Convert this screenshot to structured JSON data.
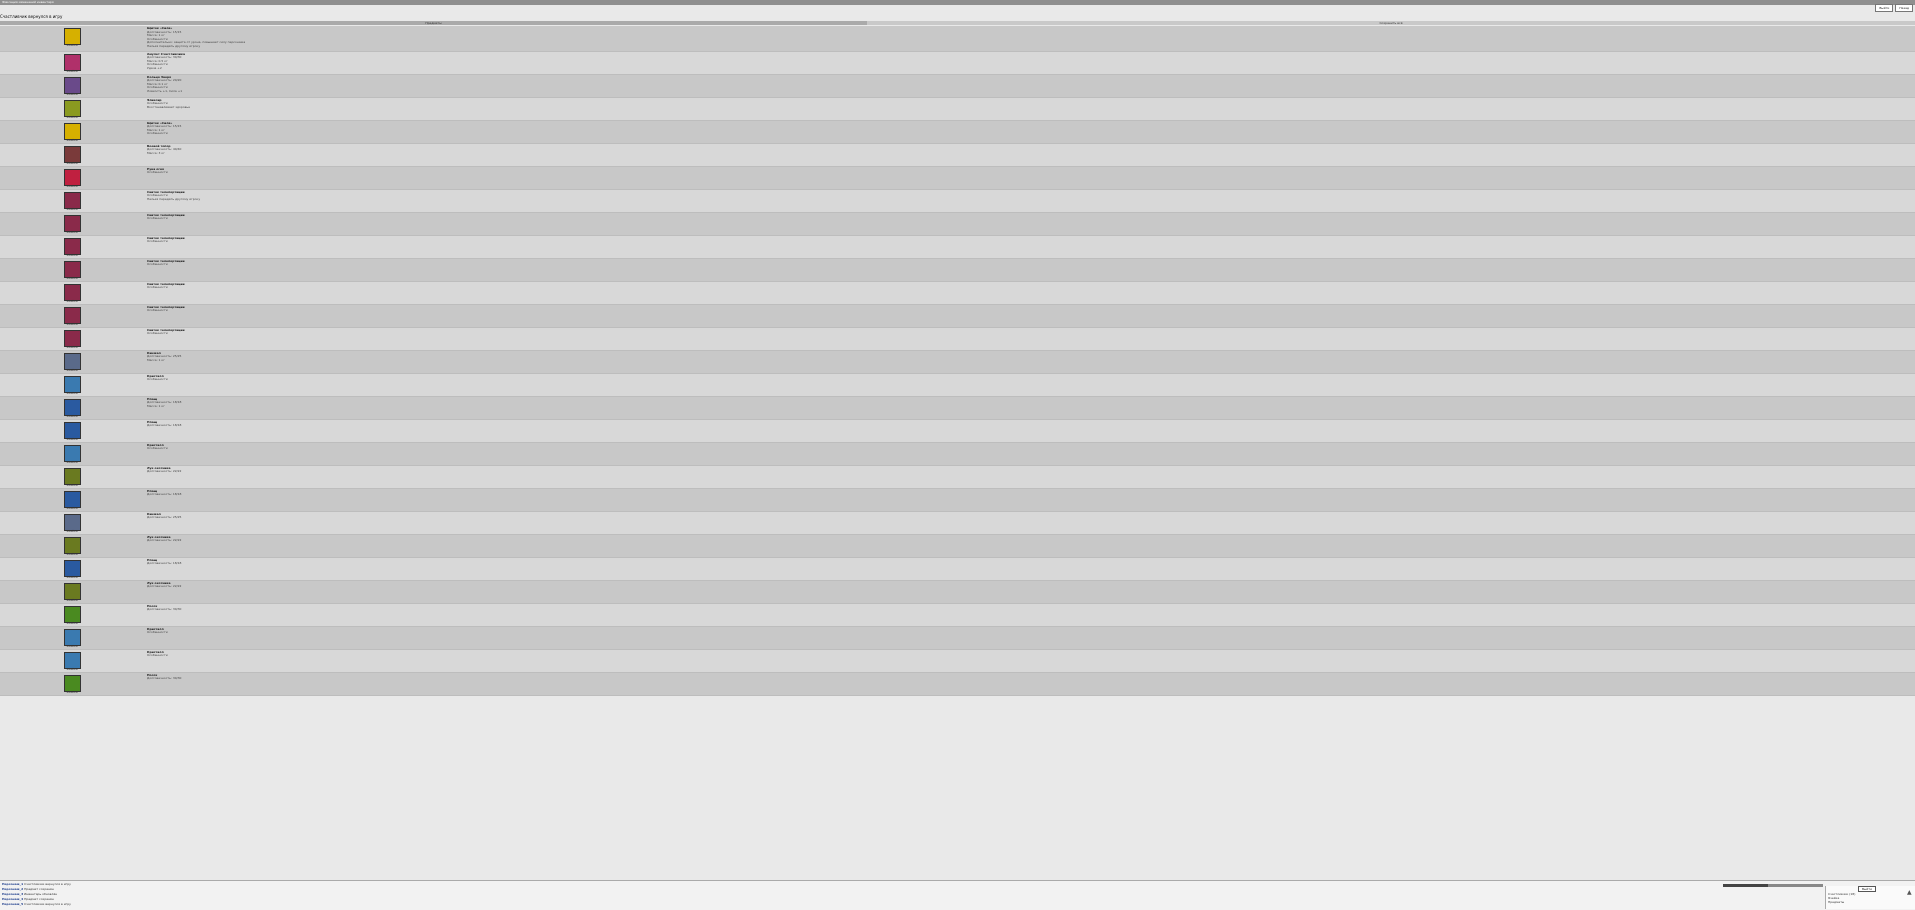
{
  "window": {
    "caption": "Фиксация изменений инвентаря"
  },
  "top_buttons": [
    "Выйти",
    "Назад"
  ],
  "title": "Счастливчик вернулся в игру",
  "columns": [
    "Предметы",
    "Сохранить всё"
  ],
  "rows": [
    {
      "icon_color": "#d6b000",
      "label": "Ячейка",
      "lines": [
        "Щиток «Сила»",
        "Долговечность: 15/15",
        "Масса: 1 кг",
        "Особенности",
        "Дополнительно: защита от урона, повышает силу персонажа",
        "Нельзя передать другому игроку"
      ]
    },
    {
      "icon_color": "#b0306a",
      "label": "Ячейка",
      "lines": [
        "Амулет Счастливчика",
        "Долговечность: 30/30",
        "Масса: 0.5 кг",
        "Особенности",
        "Удача +2"
      ]
    },
    {
      "icon_color": "#6a4a8a",
      "label": "Ячейка",
      "lines": [
        "Кольцо Зверя",
        "Долговечность: 20/20",
        "Масса: 0.1 кг",
        "Особенности",
        "Ловкость +1, Сила +1"
      ]
    },
    {
      "icon_color": "#8a9a20",
      "label": "Ячейка",
      "lines": [
        "Эликсир",
        "Особенности",
        "Восстанавливает здоровье"
      ]
    },
    {
      "icon_color": "#d6b000",
      "label": "Ячейка",
      "lines": [
        "Щиток «Сила»",
        "Долговечность: 15/15",
        "Масса: 1 кг",
        "Особенности"
      ]
    },
    {
      "icon_color": "#7a3a3a",
      "label": "Ячейка",
      "lines": [
        "Боевой топор",
        "Долговечность: 40/40",
        "Масса: 3 кг"
      ]
    },
    {
      "icon_color": "#c02040",
      "label": "Ячейка",
      "lines": [
        "Руна огня",
        "Особенности"
      ]
    },
    {
      "icon_color": "#8a2a4a",
      "label": "Ячейка",
      "lines": [
        "Свиток телепортации",
        "Особенности",
        "Нельзя передать другому игроку"
      ]
    },
    {
      "icon_color": "#8a2a4a",
      "label": "Ячейка",
      "lines": [
        "Свиток телепортации",
        "Особенности"
      ]
    },
    {
      "icon_color": "#8a2a4a",
      "label": "Ячейка",
      "lines": [
        "Свиток телепортации",
        "Особенности"
      ]
    },
    {
      "icon_color": "#8a2a4a",
      "label": "Ячейка",
      "lines": [
        "Свиток телепортации",
        "Особенности"
      ]
    },
    {
      "icon_color": "#8a2a4a",
      "label": "Ячейка",
      "lines": [
        "Свиток телепортации",
        "Особенности"
      ]
    },
    {
      "icon_color": "#8a2a4a",
      "label": "Ячейка",
      "lines": [
        "Свиток телепортации",
        "Особенности"
      ]
    },
    {
      "icon_color": "#8a2a4a",
      "label": "Ячейка",
      "lines": [
        "Свиток телепортации",
        "Особенности"
      ]
    },
    {
      "icon_color": "#5a6a8a",
      "label": "Ячейка",
      "lines": [
        "Кинжал",
        "Долговечность: 25/25",
        "Масса: 1 кг"
      ]
    },
    {
      "icon_color": "#3a7ab0",
      "label": "Ячейка",
      "lines": [
        "Кристалл",
        "Особенности"
      ]
    },
    {
      "icon_color": "#2a5aa0",
      "label": "Ячейка",
      "lines": [
        "Плащ",
        "Долговечность: 18/18",
        "Масса: 1 кг"
      ]
    },
    {
      "icon_color": "#2a5aa0",
      "label": "Ячейка",
      "lines": [
        "Плащ",
        "Долговечность: 18/18"
      ]
    },
    {
      "icon_color": "#3a7ab0",
      "label": "Ячейка",
      "lines": [
        "Кристалл",
        "Особенности"
      ]
    },
    {
      "icon_color": "#6a7a20",
      "label": "Ячейка",
      "lines": [
        "Лук охотника",
        "Долговечность: 22/22"
      ]
    },
    {
      "icon_color": "#2a5aa0",
      "label": "Ячейка",
      "lines": [
        "Плащ",
        "Долговечность: 18/18"
      ]
    },
    {
      "icon_color": "#5a6a8a",
      "label": "Ячейка",
      "lines": [
        "Кинжал",
        "Долговечность: 25/25"
      ]
    },
    {
      "icon_color": "#6a7a20",
      "label": "Ячейка",
      "lines": [
        "Лук охотника",
        "Долговечность: 22/22"
      ]
    },
    {
      "icon_color": "#2a5aa0",
      "label": "Ячейка",
      "lines": [
        "Плащ",
        "Долговечность: 18/18"
      ]
    },
    {
      "icon_color": "#6a7a20",
      "label": "Ячейка",
      "lines": [
        "Лук охотника",
        "Долговечность: 22/22"
      ]
    },
    {
      "icon_color": "#4a8a20",
      "label": "Ячейка",
      "lines": [
        "Посох",
        "Долговечность: 30/30"
      ]
    },
    {
      "icon_color": "#3a7ab0",
      "label": "Ячейка",
      "lines": [
        "Кристалл",
        "Особенности"
      ]
    },
    {
      "icon_color": "#3a7ab0",
      "label": "Ячейка",
      "lines": [
        "Кристалл",
        "Особенности"
      ]
    },
    {
      "icon_color": "#4a8a20",
      "label": "Ячейка",
      "lines": [
        "Посох",
        "Долговечность: 30/30"
      ]
    }
  ],
  "chat": [
    {
      "nick": "Персонаж_1",
      "text": "Счастливчик вернулся в игру"
    },
    {
      "nick": "Персонаж_2",
      "text": "Предмет сохранён"
    },
    {
      "nick": "Персонаж_3",
      "text": "Инвентарь обновлён"
    },
    {
      "nick": "Персонаж_4",
      "text": "Предмет сохранён"
    },
    {
      "nick": "Персонаж_5",
      "text": "Счастливчик вернулся в игру"
    }
  ],
  "progress": {
    "value": 0.45
  },
  "panel": {
    "button": "Выйти",
    "lines": [
      "Счастливчик (18)",
      "Ячейка",
      "Предметы"
    ]
  }
}
